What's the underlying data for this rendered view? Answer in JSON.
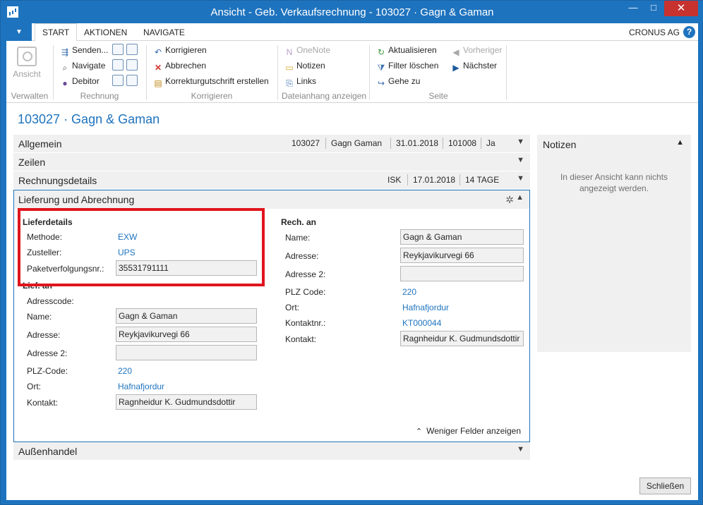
{
  "window": {
    "title": "Ansicht - Geb. Verkaufsrechnung - 103027 · Gagn & Gaman",
    "minimize": "—",
    "maximize": "□",
    "close": "✕"
  },
  "ribbon": {
    "file_menu": "▼",
    "tabs": [
      {
        "label": "START",
        "active": true
      },
      {
        "label": "AKTIONEN",
        "active": false
      },
      {
        "label": "NAVIGATE",
        "active": false
      }
    ],
    "company": "CRONUS AG",
    "help": "?",
    "groups": {
      "verwalten": {
        "label": "Verwalten",
        "ansicht": "Ansicht"
      },
      "rechnung": {
        "label": "Rechnung",
        "senden": "Senden...",
        "navigate": "Navigate",
        "debitor": "Debitor"
      },
      "korrigieren": {
        "label": "Korrigieren",
        "korrigieren": "Korrigieren",
        "abbrechen": "Abbrechen",
        "korrekturgutschrift": "Korrekturgutschrift erstellen"
      },
      "dateianhang": {
        "label": "Dateianhang anzeigen",
        "onenote": "OneNote",
        "notizen": "Notizen",
        "links": "Links"
      },
      "seite": {
        "label": "Seite",
        "aktualisieren": "Aktualisieren",
        "filter_loeschen": "Filter löschen",
        "gehe_zu": "Gehe zu",
        "vorheriger": "Vorheriger",
        "naechster": "Nächster"
      }
    }
  },
  "page": {
    "title": "103027 · Gagn & Gaman"
  },
  "fasttabs": {
    "allgemein": {
      "label": "Allgemein",
      "summary": [
        "103027",
        "Gagn  Gaman",
        "31.01.2018",
        "101008",
        "Ja"
      ]
    },
    "zeilen": {
      "label": "Zeilen"
    },
    "rechnungsdetails": {
      "label": "Rechnungsdetails",
      "summary": [
        "ISK",
        "17.01.2018",
        "14 TAGE"
      ]
    },
    "lieferung": {
      "label": "Lieferung und Abrechnung"
    },
    "aussenhandel": {
      "label": "Außenhandel"
    }
  },
  "lieferdetails": {
    "title": "Lieferdetails",
    "methode_label": "Methode:",
    "methode": "EXW",
    "zusteller_label": "Zusteller:",
    "zusteller": "UPS",
    "paket_label": "Paketverfolgungsnr.:",
    "paket": "35531791111"
  },
  "lief_an": {
    "title": "Lief. an",
    "adresscode_label": "Adresscode:",
    "name_label": "Name:",
    "name": "Gagn & Gaman",
    "adresse_label": "Adresse:",
    "adresse": "Reykjavikurvegi 66",
    "adresse2_label": "Adresse 2:",
    "adresse2": "",
    "plz_label": "PLZ-Code:",
    "plz": "220",
    "ort_label": "Ort:",
    "ort": "Hafnafjordur",
    "kontakt_label": "Kontakt:",
    "kontakt": "Ragnheidur K. Gudmundsdottir"
  },
  "rech_an": {
    "title": "Rech. an",
    "name_label": "Name:",
    "name": "Gagn & Gaman",
    "adresse_label": "Adresse:",
    "adresse": "Reykjavikurvegi 66",
    "adresse2_label": "Adresse 2:",
    "adresse2": "",
    "plz_label": "PLZ Code:",
    "plz": "220",
    "ort_label": "Ort:",
    "ort": "Hafnafjordur",
    "kontaktnr_label": "Kontaktnr.:",
    "kontaktnr": "KT000044",
    "kontakt_label": "Kontakt:",
    "kontakt": "Ragnheidur K. Gudmundsdottir"
  },
  "less_fields": "Weniger Felder anzeigen",
  "notes": {
    "title": "Notizen",
    "empty_text": "In dieser Ansicht kann nichts angezeigt werden."
  },
  "close_button": "Schließen",
  "colors": {
    "accent": "#1e73be",
    "highlight": "#e0151d"
  }
}
